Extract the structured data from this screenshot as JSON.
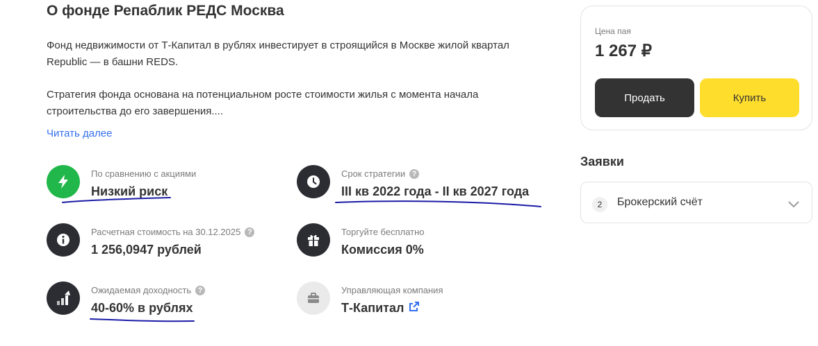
{
  "about": {
    "title": "О фонде Репаблик РЕДС Москва",
    "paragraph1": "Фонд недвижимости от Т-Капитал в рублях инвестирует в строящийся в Москве жилой квартал Republic — в башни REDS.",
    "paragraph2": "Стратегия фонда основана на потенциальном росте стоимости жилья с момента начала строительства до его завершения....",
    "read_more": "Читать далее"
  },
  "features": {
    "risk": {
      "label": "По сравнению с акциями",
      "value": "Низкий риск",
      "icon": "lightning-icon"
    },
    "term": {
      "label": "Срок стратегии",
      "value": "III кв 2022 года - II кв 2027 года",
      "icon": "clock-icon"
    },
    "valuation": {
      "label": "Расчетная стоимость на 30.12.2025",
      "value": "1 256,0947 рублей",
      "icon": "info-icon"
    },
    "commission": {
      "label": "Торгуйте бесплатно",
      "value": "Комиссия 0%",
      "icon": "gift-icon"
    },
    "yield": {
      "label": "Ожидаемая доходность",
      "value": "40-60% в рублях",
      "icon": "growth-chart-icon"
    },
    "company": {
      "label": "Управляющая компания",
      "value": "Т-Капитал",
      "icon": "briefcase-icon"
    }
  },
  "trade": {
    "price_label": "Цена пая",
    "price_value": "1 267 ₽",
    "sell_label": "Продать",
    "buy_label": "Купить"
  },
  "orders": {
    "title": "Заявки",
    "account_count": "2",
    "account_label": "Брокерский счёт"
  },
  "colors": {
    "accent_yellow": "#ffdd2d",
    "dark_button": "#333333",
    "link_blue": "#336fee",
    "risk_green": "#21b74a",
    "pen_underline": "#1a1aa6"
  }
}
